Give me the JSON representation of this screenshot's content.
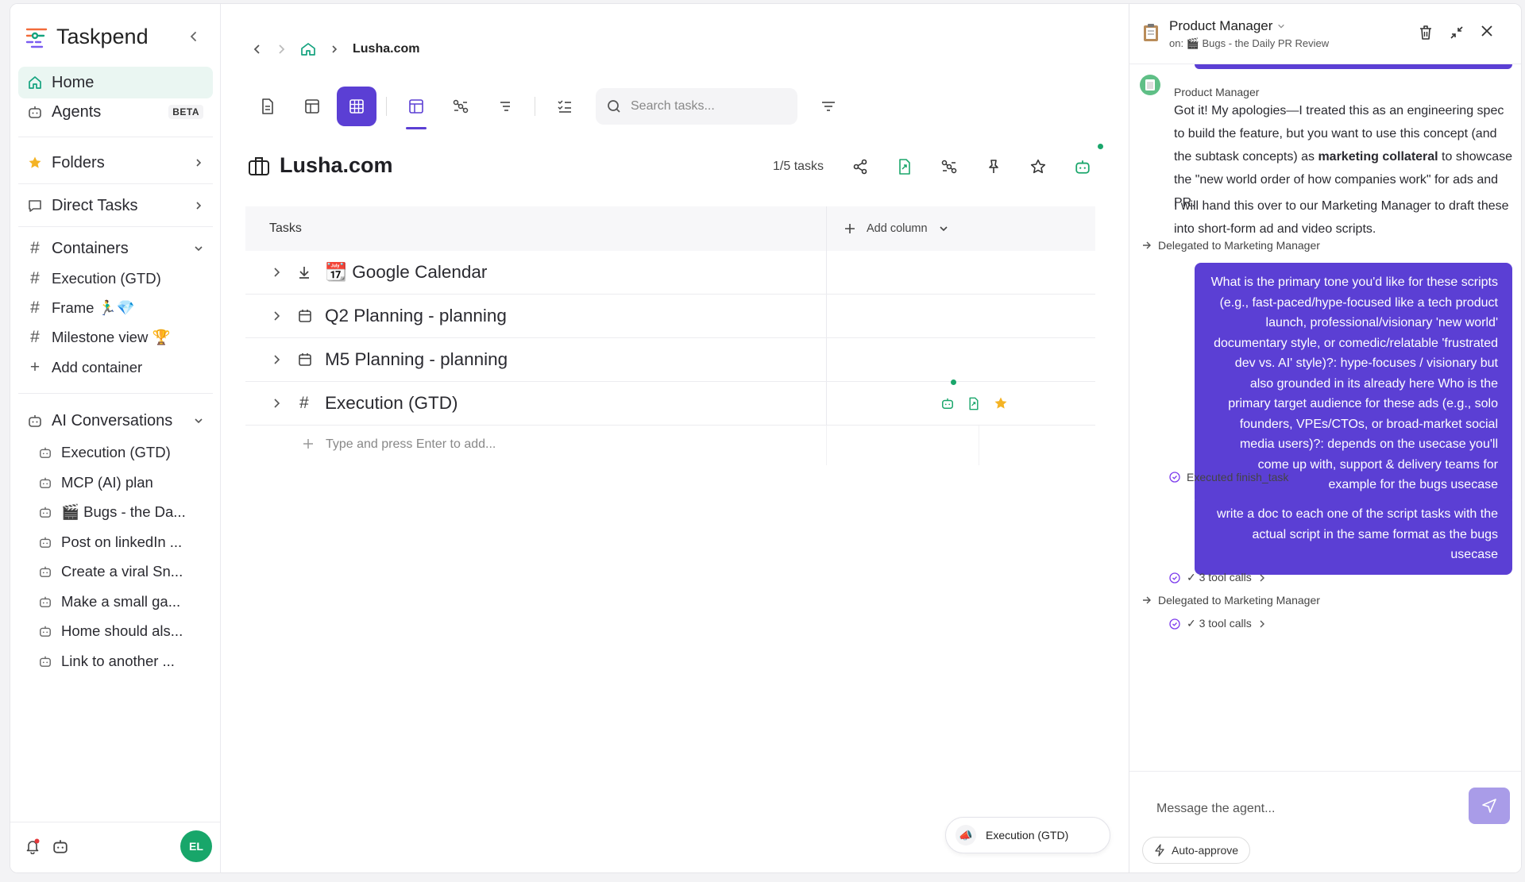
{
  "app": {
    "name": "Taskpend"
  },
  "sidebar": {
    "home": "Home",
    "agents": "Agents",
    "beta": "BETA",
    "folders": "Folders",
    "direct_tasks": "Direct Tasks",
    "containers": "Containers",
    "container_items": [
      "Execution (GTD)",
      "Frame 🏃‍♂️💎",
      "Milestone view 🏆"
    ],
    "add_container": "Add container",
    "ai_conversations": "AI Conversations",
    "conversations": [
      "Execution (GTD)",
      "MCP (AI) plan",
      "🎬 Bugs - the Da...",
      "Post on linkedIn ...",
      "Create a viral Sn...",
      "Make a small ga...",
      "Home should als...",
      "Link to another ..."
    ],
    "user_initials": "EL"
  },
  "breadcrumb": {
    "current": "Lusha.com"
  },
  "search": {
    "placeholder": "Search tasks..."
  },
  "page": {
    "title": "Lusha.com",
    "task_count": "1/5 tasks"
  },
  "table": {
    "col_tasks": "Tasks",
    "add_column": "Add column",
    "rows": [
      "📆 Google Calendar",
      "Q2 Planning - planning",
      "M5 Planning - planning",
      "Execution (GTD)"
    ],
    "add_placeholder": "Type and press Enter to add..."
  },
  "float_pill": {
    "label": "Execution (GTD)"
  },
  "panel": {
    "agent_title": "Product Manager",
    "subtitle": "on: 🎬 Bugs - the Daily PR Review",
    "agent_name": "Product Manager",
    "msg1_part1": "Got it! My apologies—I treated this as an engineering spec to build the feature, but you want to use this concept (and the subtask concepts) as ",
    "msg1_bold": "marketing collateral",
    "msg1_part2": " to showcase the \"new world order of how companies work\" for ads and PR.",
    "msg1_p2": "I will hand this over to our Marketing Manager to draft these into short-form ad and video scripts.",
    "delegated_1": "Delegated to Marketing Manager",
    "user_msg1": "What is the primary tone you'd like for these scripts (e.g., fast-paced/hype-focused like a tech product launch, professional/visionary 'new world' documentary style, or comedic/relatable 'frustrated dev vs. AI' style)?: hype-focuses / visionary but also grounded in its already here Who is the primary target audience for these ads (e.g., solo founders, VPEs/CTOs, or broad-market social media users)?: depends on the usecase you'll come up with, support & delivery teams for example for the bugs usecase",
    "executed": "Executed finish_task",
    "user_msg2": "write a doc to each one of the script tasks with the actual script in the same format as the bugs usecase",
    "tool_calls_1": "✓ 3 tool calls",
    "delegated_2": "Delegated to Marketing Manager",
    "tool_calls_2": "✓ 3 tool calls",
    "composer_placeholder": "Message the agent...",
    "auto_approve": "Auto-approve"
  }
}
